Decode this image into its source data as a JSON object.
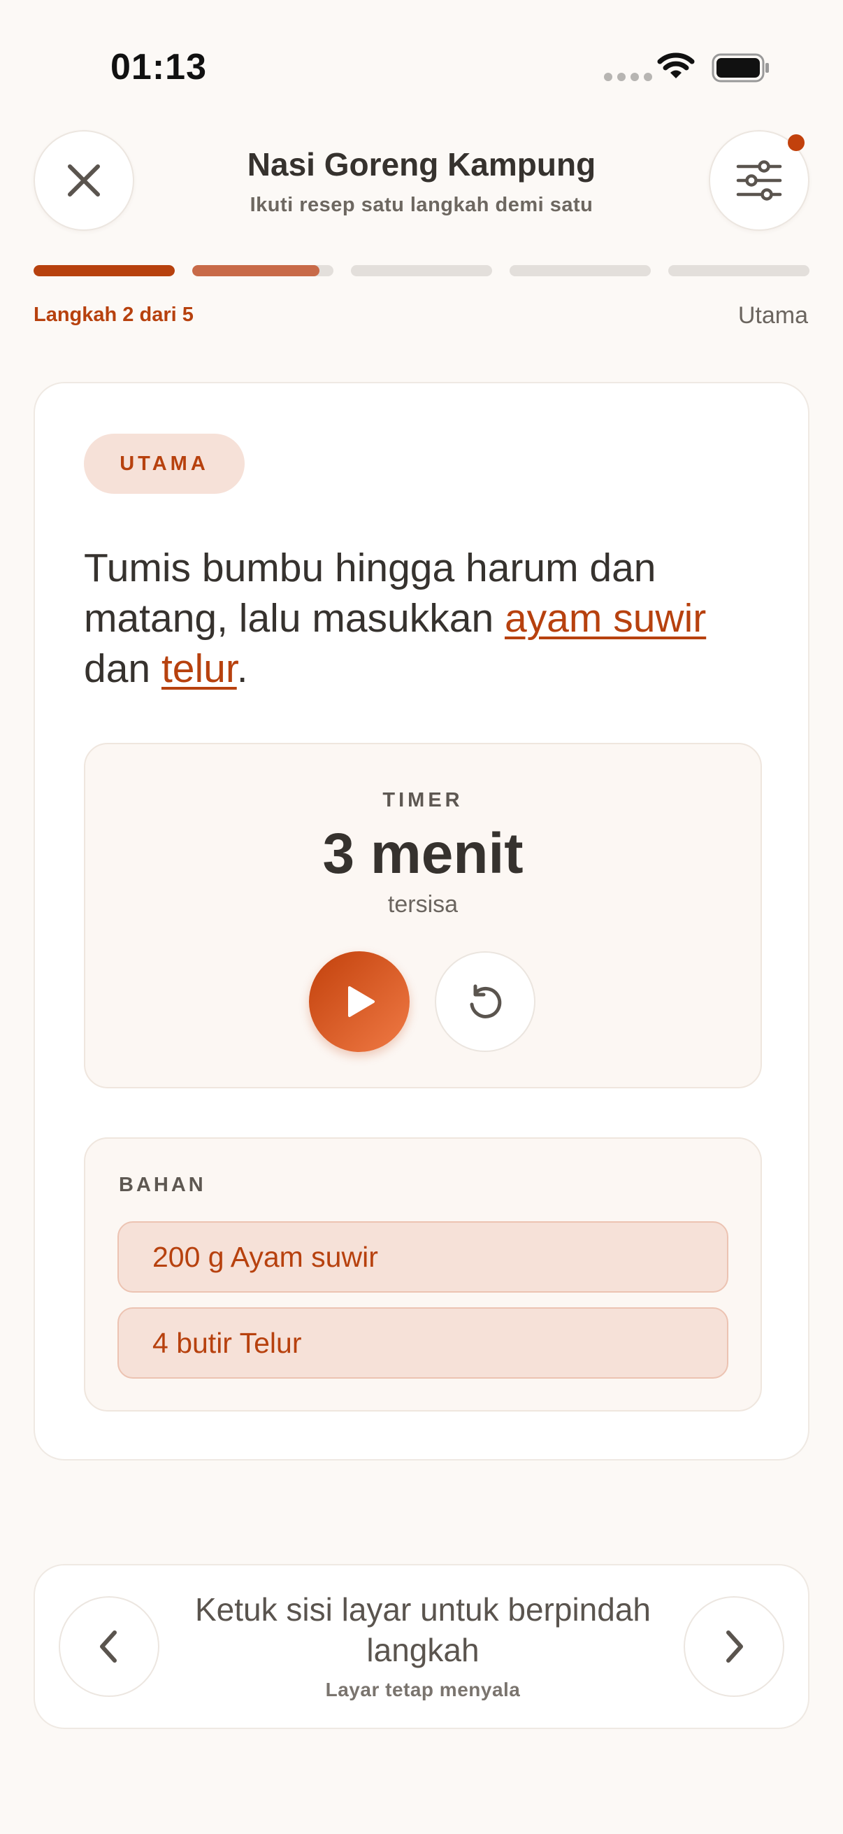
{
  "status_bar": {
    "time": "01:13"
  },
  "header": {
    "title": "Nasi Goreng Kampung",
    "subtitle": "Ikuti resep satu langkah demi satu",
    "close_icon": "close-icon",
    "settings_icon": "sliders-icon",
    "has_notification": true
  },
  "progress": {
    "total_steps": 5,
    "current_step": 2,
    "segments": [
      1.0,
      0.9,
      0,
      0,
      0
    ],
    "step_label": "Langkah 2 dari 5",
    "category": "Utama"
  },
  "step": {
    "badge": "UTAMA",
    "instruction_parts": [
      {
        "text": "Tumis bumbu hingga harum dan matang, lalu masukkan "
      },
      {
        "text": "ayam suwir",
        "link": true
      },
      {
        "text": "\ndan "
      },
      {
        "text": "telur",
        "link": true
      },
      {
        "text": "."
      }
    ],
    "timer": {
      "label": "TIMER",
      "value": "3 menit",
      "remaining": "tersisa",
      "play_icon": "play-icon",
      "reset_icon": "reset-icon"
    },
    "ingredients": {
      "title": "BAHAN",
      "items": [
        "200 g Ayam suwir",
        "4 butir Telur"
      ]
    }
  },
  "bottom_nav": {
    "hint": "Ketuk sisi layar untuk berpindah langkah",
    "sub": "Layar tetap menyala",
    "prev_icon": "chevron-left-icon",
    "next_icon": "chevron-right-icon"
  },
  "colors": {
    "accent": "#c2410c",
    "accent_text": "#b7410e",
    "accent_soft": "#f6e1d8",
    "background": "#fcf9f6",
    "text": "#36322e"
  }
}
